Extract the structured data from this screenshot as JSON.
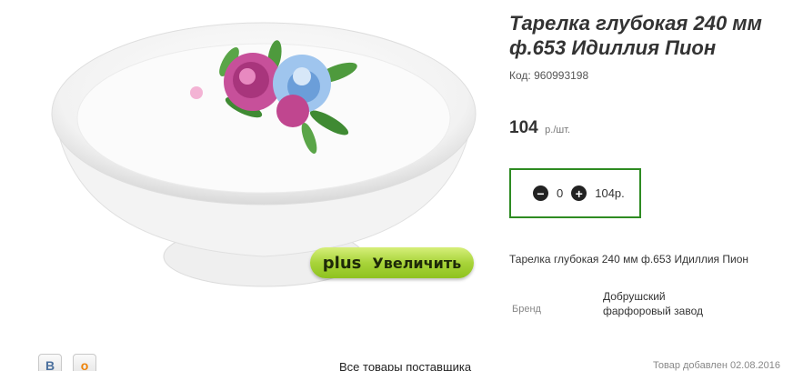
{
  "product": {
    "title": "Тарелка глубокая 240 мм ф.653 Идиллия Пион",
    "sku_label": "Код:",
    "sku": "960993198",
    "price": "104",
    "price_unit": "р./шт.",
    "description": "Тарелка глубокая 240 мм ф.653 Идиллия Пион",
    "brand_label": "Бренд",
    "brand": "Добрушский фарфоровый завод",
    "added": "Товар добавлен 02.08.2016"
  },
  "cart": {
    "minus_icon": "minus-circle-icon",
    "quantity": "0",
    "plus_icon": "plus-circle-icon",
    "total": "104р."
  },
  "image": {
    "zoom_label": "Увеличить",
    "zoom_icon": "plus"
  },
  "footer": {
    "supplier_link": "Все товары поставщика",
    "social": [
      {
        "name": "vkontakte",
        "glyph": "В"
      },
      {
        "name": "odnoklassniki",
        "glyph": "о"
      }
    ]
  },
  "colors": {
    "accent_border": "#2e8b22",
    "zoom_button": "#a8d43a"
  }
}
